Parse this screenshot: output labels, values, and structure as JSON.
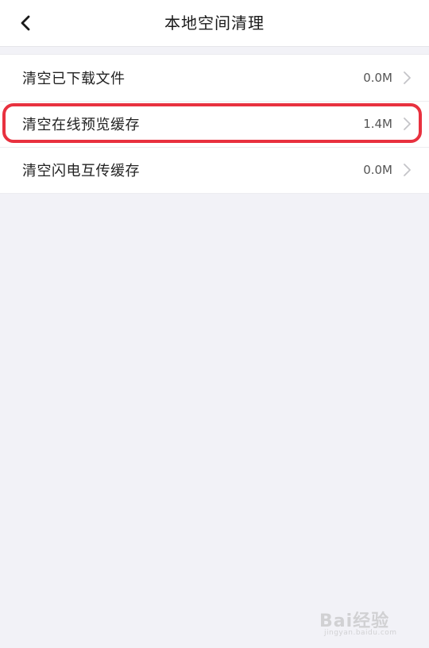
{
  "header": {
    "title": "本地空间清理",
    "back_icon": "chevron-left-icon"
  },
  "list": {
    "items": [
      {
        "label": "清空已下载文件",
        "size": "0.0M"
      },
      {
        "label": "清空在线预览缓存",
        "size": "1.4M",
        "highlighted": true
      },
      {
        "label": "清空闪电互传缓存",
        "size": "0.0M"
      }
    ]
  },
  "watermark": {
    "text": "Bai经验",
    "sub": "jingyan.baidu.com"
  },
  "colors": {
    "background": "#f2f2f7",
    "highlight": "#e8313f",
    "chevron": "#c4c4c8"
  }
}
